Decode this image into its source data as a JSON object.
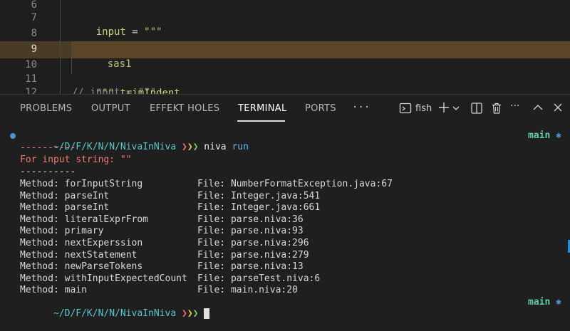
{
  "editor": {
    "lines": [
      {
        "num": "6",
        "text": ""
      },
      {
        "num": "7",
        "keyword": "input",
        "op": " = ",
        "str": "\"\"\""
      },
      {
        "num": "8",
        "text": ""
      },
      {
        "num": "9",
        "str": "sas1"
      },
      {
        "num": "10",
        "text": ""
      },
      {
        "num": "11",
        "str": "\"\"\"",
        "keyword": " trimIndent"
      },
      {
        "num": "12",
        "text": "// input = \"\"\""
      }
    ]
  },
  "panel": {
    "tabs": [
      "PROBLEMS",
      "OUTPUT",
      "EFFEKT HOLES",
      "TERMINAL",
      "PORTS"
    ],
    "active_tab": "TERMINAL",
    "more": "···",
    "shell_name": "fish",
    "icons": [
      "terminal-icon",
      "plus-icon",
      "chevron-down-icon",
      "split-icon",
      "trash-icon",
      "more-icon",
      "chevron-up-icon",
      "close-icon"
    ]
  },
  "terminal": {
    "path": "~/D/F/K/N/N/NivaInNiva",
    "chevrons": [
      "❯",
      "❯",
      "❯"
    ],
    "command": "niva",
    "arg": "run",
    "separator": "----------",
    "error": "For input string: \"\"",
    "stack": [
      {
        "method": "Method: forInputString",
        "file": "File: NumberFormatException.java:67"
      },
      {
        "method": "Method: parseInt",
        "file": "File: Integer.java:541"
      },
      {
        "method": "Method: parseInt",
        "file": "File: Integer.java:661"
      },
      {
        "method": "Method: literalExprFrom",
        "file": "File: parse.niva:36"
      },
      {
        "method": "Method: primary",
        "file": "File: parse.niva:93"
      },
      {
        "method": "Method: nextExperssion",
        "file": "File: parse.niva:296"
      },
      {
        "method": "Method: nextStatement",
        "file": "File: parse.niva:279"
      },
      {
        "method": "Method: newParseTokens",
        "file": "File: parse.niva:13"
      },
      {
        "method": "Method: withInputExpectedCount",
        "file": "File: parseTest.niva:6"
      },
      {
        "method": "Method: main",
        "file": "File: main.niva:20"
      }
    ],
    "branch": "main",
    "branch_marker": "✱"
  },
  "colors": {
    "path": "#5cc6c9",
    "error": "#f37b6f",
    "branch": "#5cd0a0",
    "highlight": "#5b4526"
  }
}
